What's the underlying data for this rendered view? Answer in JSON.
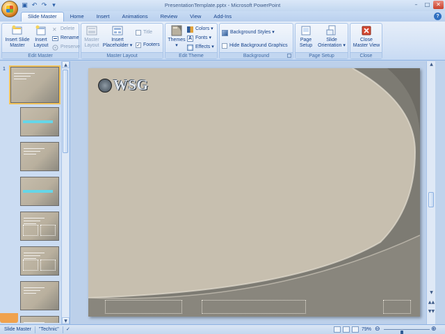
{
  "window": {
    "title": "PresentationTemplate.pptx - Microsoft PowerPoint",
    "quick_access": [
      {
        "name": "save-icon",
        "glyph": "▣"
      },
      {
        "name": "undo-icon",
        "glyph": "↶"
      },
      {
        "name": "redo-icon",
        "glyph": "↷"
      },
      {
        "name": "customize-qat-icon",
        "glyph": "▾"
      }
    ],
    "controls": {
      "minimize": "–",
      "maximize": "□",
      "close": "✕"
    }
  },
  "tabs": [
    "Slide Master",
    "Home",
    "Insert",
    "Animations",
    "Review",
    "View",
    "Add-Ins"
  ],
  "active_tab": "Slide Master",
  "ribbon": {
    "edit_master": {
      "label": "Edit Master",
      "insert_slide_master": "Insert Slide\nMaster",
      "insert_layout": "Insert\nLayout",
      "delete": "Delete",
      "rename": "Rename",
      "preserve": "Preserve"
    },
    "master_layout": {
      "label": "Master Layout",
      "master_layout": "Master\nLayout",
      "insert_placeholder": "Insert\nPlaceholder ▾",
      "title": "Title",
      "footers": "Footers",
      "title_checked": false,
      "footers_checked": true
    },
    "edit_theme": {
      "label": "Edit Theme",
      "themes": "Themes",
      "colors": "Colors ▾",
      "fonts": "Fonts ▾",
      "effects": "Effects ▾"
    },
    "background": {
      "label": "Background",
      "styles": "Background Styles ▾",
      "hide_graphics": "Hide Background Graphics",
      "hide_checked": false
    },
    "page_setup": {
      "label": "Page Setup",
      "page_setup": "Page\nSetup",
      "orientation": "Slide\nOrientation ▾"
    },
    "close": {
      "label": "Close",
      "close_master_view": "Close\nMaster View"
    }
  },
  "thumbnails": {
    "first_number": "1",
    "count": 8
  },
  "slide": {
    "logo_text": "WSG"
  },
  "status": {
    "view_name": "Slide Master",
    "theme_name": "\"Technic\"",
    "zoom": "79%",
    "zoom_percent": 79,
    "zoom_out": "⊖",
    "zoom_in": "⊕"
  },
  "colors": {
    "slide_bg": "#c7bfaf",
    "slide_dark": "#7a7870",
    "ribbon_text": "#15428b",
    "close_btn": "#c7412c"
  }
}
